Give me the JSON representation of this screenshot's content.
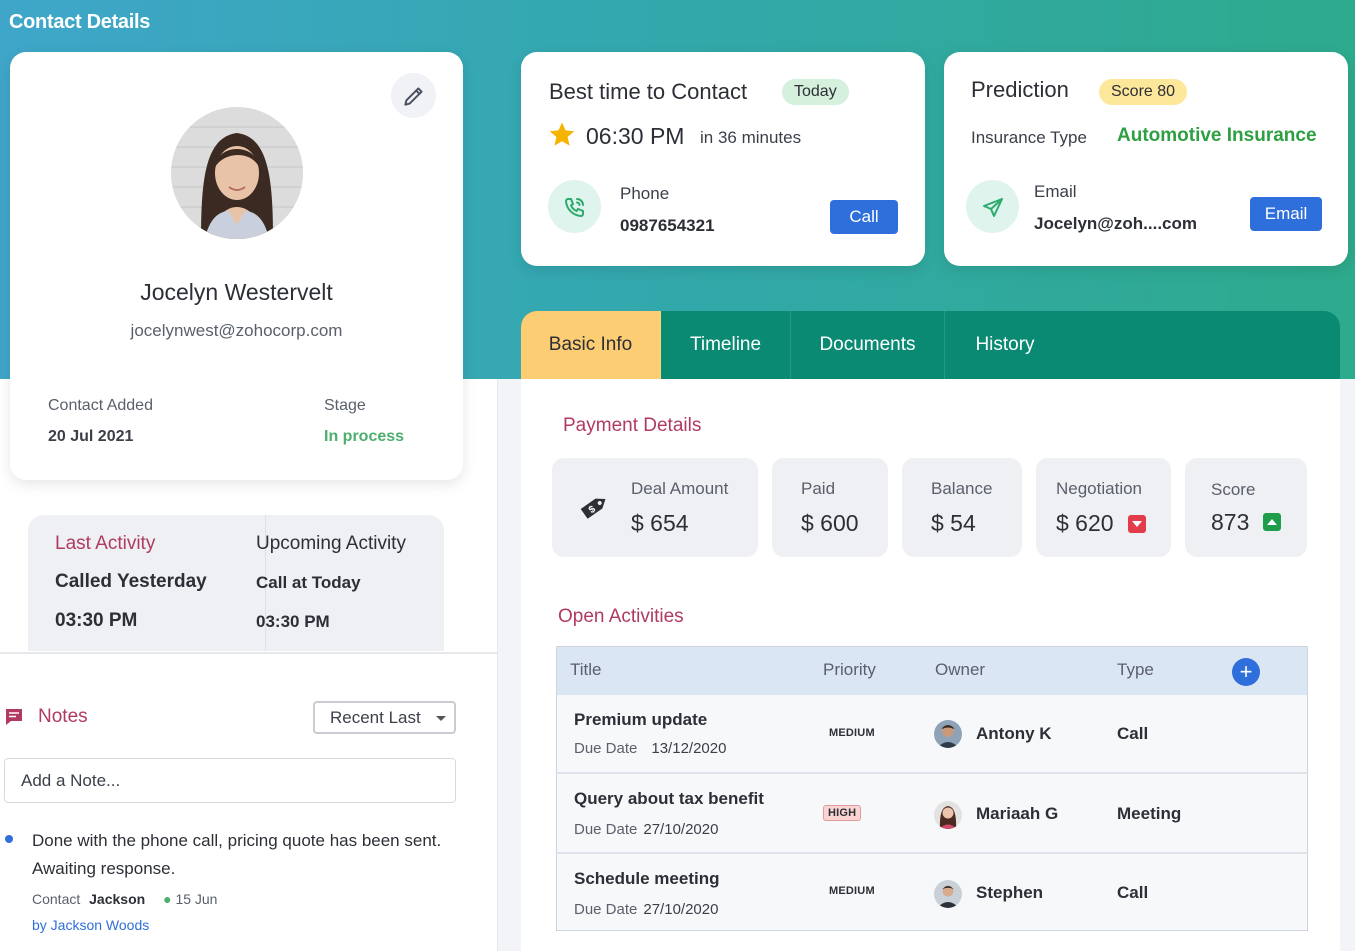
{
  "page": {
    "title": "Contact Details"
  },
  "profile": {
    "name": "Jocelyn Westervelt",
    "email": "jocelynwest@zohocorp.com",
    "contact_added_label": "Contact Added",
    "contact_added_value": "20 Jul 2021",
    "stage_label": "Stage",
    "stage_value": "In process",
    "stage_color": "#4caf6b"
  },
  "best_time": {
    "title": "Best time to Contact",
    "badge": "Today",
    "time": "06:30 PM",
    "relative": "in 36 minutes",
    "phone_label": "Phone",
    "phone_value": "0987654321",
    "call_button": "Call"
  },
  "prediction": {
    "title": "Prediction",
    "badge": "Score 80",
    "insurance_label": "Insurance Type",
    "insurance_value": "Automotive Insurance",
    "email_label": "Email",
    "email_value": "Jocelyn@zoh....com",
    "email_button": "Email"
  },
  "activity": {
    "last_label": "Last Activity",
    "last_value": "Called Yesterday",
    "last_time": "03:30 PM",
    "upcoming_label": "Upcoming Activity",
    "upcoming_value": "Call at Today",
    "upcoming_time": "03:30 PM"
  },
  "notes": {
    "title": "Notes",
    "sort_selected": "Recent Last",
    "input_placeholder": "Add a Note...",
    "items": [
      {
        "text": "Done with the phone call, pricing quote has been sent. Awaiting response.",
        "contact_label": "Contact",
        "contact_name": "Jackson",
        "date": "15 Jun",
        "author": "by Jackson Woods"
      }
    ]
  },
  "tabs": [
    {
      "label": "Basic Info",
      "active": true
    },
    {
      "label": "Timeline",
      "active": false
    },
    {
      "label": "Documents",
      "active": false
    },
    {
      "label": "History",
      "active": false
    }
  ],
  "payment": {
    "title": "Payment Details",
    "stats": [
      {
        "label": "Deal Amount",
        "value": "$ 654",
        "icon": "price-tag-icon"
      },
      {
        "label": "Paid",
        "value": "$ 600"
      },
      {
        "label": "Balance",
        "value": "$ 54"
      },
      {
        "label": "Negotiation",
        "value": "$ 620",
        "trend": "down"
      },
      {
        "label": "Score",
        "value": "873",
        "trend": "up"
      }
    ]
  },
  "open_activities": {
    "title": "Open Activities",
    "columns": [
      "Title",
      "Priority",
      "Owner",
      "Type"
    ],
    "rows": [
      {
        "title": "Premium update",
        "due_label": "Due Date",
        "due_date": "13/12/2020",
        "priority": "MEDIUM",
        "owner": "Antony K",
        "type": "Call"
      },
      {
        "title": "Query about tax benefit",
        "due_label": "Due Date",
        "due_date": "27/10/2020",
        "priority": "HIGH",
        "owner": "Mariaah G",
        "type": "Meeting"
      },
      {
        "title": "Schedule meeting",
        "due_label": "Due Date",
        "due_date": "27/10/2020",
        "priority": "MEDIUM",
        "owner": "Stephen",
        "type": "Call"
      }
    ]
  },
  "colors": {
    "accent_teal": "#0a8a73",
    "tab_active": "#fdcd74",
    "section_title": "#b03a62",
    "primary_button": "#2f6fdb",
    "insurance_green": "#2ea043"
  }
}
